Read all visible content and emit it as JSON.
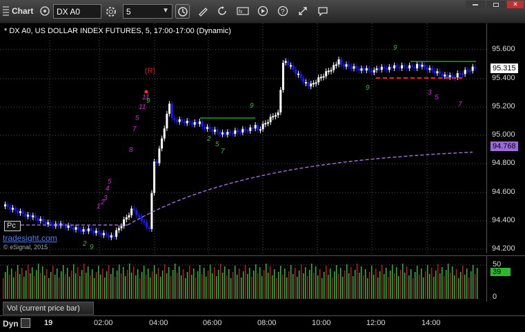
{
  "toolbar": {
    "app_label": "Chart",
    "symbol_value": "DX A0",
    "interval_value": "5"
  },
  "chart": {
    "title": "* DX A0, US DOLLAR INDEX FUTURES, 5, 17:00-17:00 (Dynamic)",
    "last_price": "95.315",
    "ma_price": "94.768",
    "signal_label": "(R)",
    "price_ticks": [
      "95.600",
      "95.400",
      "95.200",
      "95.000",
      "94.800",
      "94.600",
      "94.400",
      "94.200"
    ],
    "time_ticks": [
      "19",
      "02:00",
      "04:00",
      "06:00",
      "08:00",
      "10:00",
      "12:00",
      "14:00"
    ],
    "colors": {
      "up": "#ffffff",
      "down": "#1a1aff",
      "ma": "#9b6bd6",
      "support": "#ff2020",
      "resistance": "#1aa61a",
      "count_buy": "#e020e0",
      "count_sell": "#3cb83c"
    }
  },
  "volume": {
    "label": "Vol (current price bar)",
    "axis_ticks": [
      "50",
      "0"
    ],
    "current": "39"
  },
  "footer": {
    "dyn_label": "Dyn",
    "tradesight": "tradesight.com",
    "esignal": "© eSignal, 2015",
    "pc_label": "Pc"
  }
}
